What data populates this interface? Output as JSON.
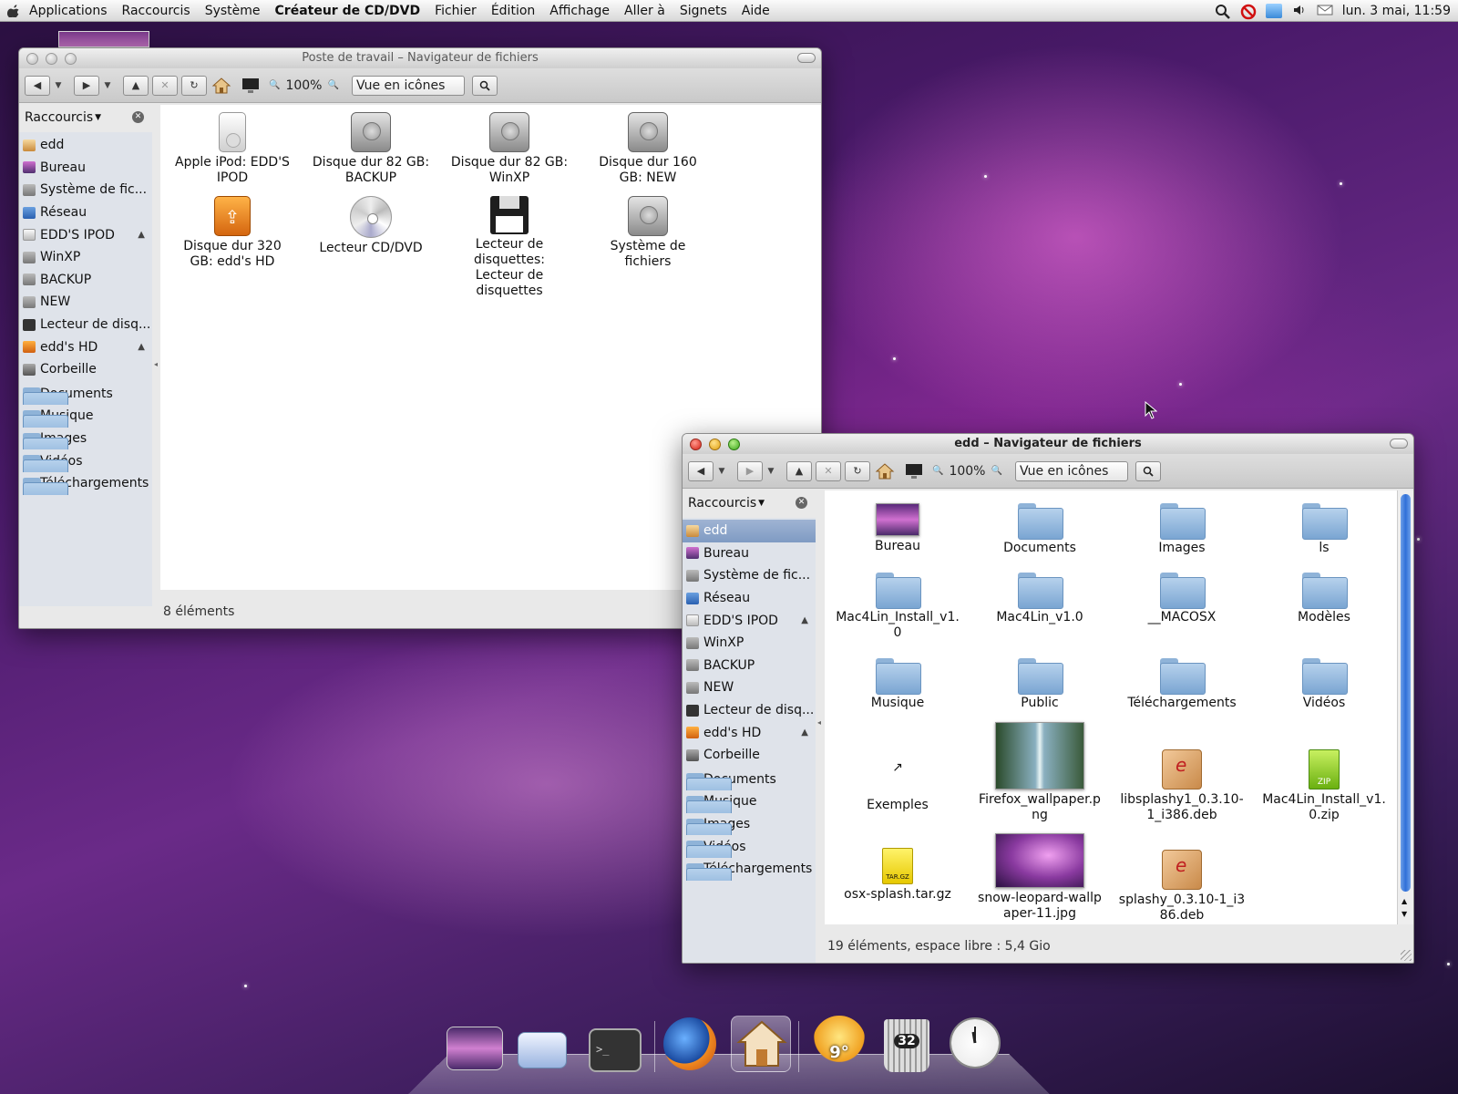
{
  "menubar": {
    "items": [
      "Applications",
      "Raccourcis",
      "Système"
    ],
    "app_name": "Créateur de CD/DVD",
    "app_menus": [
      "Fichier",
      "Édition",
      "Affichage",
      "Aller à",
      "Signets",
      "Aide"
    ],
    "clock": "lun.  3 mai, 11:59"
  },
  "window1": {
    "title": "Poste de travail – Navigateur de fichiers",
    "zoom": "100%",
    "view_mode": "Vue en icônes",
    "sidebar_title": "Raccourcis",
    "status": "8 éléments",
    "items": [
      {
        "label": "Apple iPod: EDD'S IPOD",
        "icon": "ipod-icon"
      },
      {
        "label": "Disque dur 82 GB: BACKUP",
        "icon": "hard-disk-icon"
      },
      {
        "label": "Disque dur 82 GB: WinXP",
        "icon": "hard-disk-icon"
      },
      {
        "label": "Disque dur 160 GB: NEW",
        "icon": "hard-disk-icon"
      },
      {
        "label": "Disque dur 320 GB: edd's HD",
        "icon": "usb-disk-icon"
      },
      {
        "label": "Lecteur CD/DVD",
        "icon": "cd-icon"
      },
      {
        "label": "Lecteur de disquettes: Lecteur de disquettes",
        "icon": "floppy-icon"
      },
      {
        "label": "Système de fichiers",
        "icon": "hard-disk-icon"
      }
    ]
  },
  "sidebar_places": [
    {
      "label": "edd",
      "icon": "home"
    },
    {
      "label": "Bureau",
      "icon": "desk"
    },
    {
      "label": "Système de fic...",
      "icon": "disk"
    },
    {
      "label": "Réseau",
      "icon": "net"
    },
    {
      "label": "EDD'S IPOD",
      "icon": "ipod",
      "eject": "▲"
    },
    {
      "label": "WinXP",
      "icon": "disk"
    },
    {
      "label": "BACKUP",
      "icon": "disk"
    },
    {
      "label": "NEW",
      "icon": "disk"
    },
    {
      "label": "Lecteur de disq...",
      "icon": "floppy"
    },
    {
      "label": "edd's HD",
      "icon": "usb",
      "eject": "▲"
    },
    {
      "label": "Corbeille",
      "icon": "trash"
    }
  ],
  "sidebar_bookmarks": [
    "Documents",
    "Musique",
    "Images",
    "Vidéos",
    "Téléchargements"
  ],
  "window2": {
    "title": "edd – Navigateur de fichiers",
    "zoom": "100%",
    "view_mode": "Vue en icônes",
    "sidebar_title": "Raccourcis",
    "status": "19 éléments, espace libre : 5,4 Gio",
    "items": [
      {
        "label": "Bureau",
        "icon": "desktop-thumb"
      },
      {
        "label": "Documents",
        "icon": "folder-icon"
      },
      {
        "label": "Images",
        "icon": "folder-icon"
      },
      {
        "label": "ls",
        "icon": "folder-icon"
      },
      {
        "label": "Mac4Lin_Install_v1.0",
        "icon": "folder-icon"
      },
      {
        "label": "Mac4Lin_v1.0",
        "icon": "folder-icon"
      },
      {
        "label": "__MACOSX",
        "icon": "folder-icon"
      },
      {
        "label": "Modèles",
        "icon": "folder-icon"
      },
      {
        "label": "Musique",
        "icon": "folder-icon"
      },
      {
        "label": "Public",
        "icon": "folder-icon"
      },
      {
        "label": "Téléchargements",
        "icon": "folder-icon"
      },
      {
        "label": "Vidéos",
        "icon": "folder-icon"
      },
      {
        "label": "Exemples",
        "icon": "symlink-icon"
      },
      {
        "label": "Firefox_wallpaper.png",
        "icon": "image-thumb"
      },
      {
        "label": "libsplashy1_0.3.10-1_i386.deb",
        "icon": "deb-package-icon"
      },
      {
        "label": "Mac4Lin_Install_v1.0.zip",
        "icon": "zip-icon"
      },
      {
        "label": "osx-splash.tar.gz",
        "icon": "targz-icon"
      },
      {
        "label": "snow-leopard-wallpaper-11.jpg",
        "icon": "image-thumb"
      },
      {
        "label": "splashy_0.3.10-1_i386.deb",
        "icon": "deb-package-icon"
      }
    ]
  },
  "dock": {
    "items": [
      "desktop-preview-icon",
      "workspace-switcher-icon",
      "terminal-icon",
      "firefox-icon",
      "home-finder-icon",
      "weather-icon",
      "trash-icon",
      "clock-icon"
    ],
    "weather_temp": "9°",
    "trash_count": "32"
  }
}
